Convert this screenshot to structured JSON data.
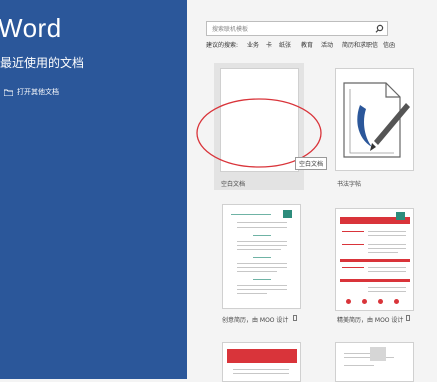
{
  "sidebar": {
    "app_title": "Word",
    "recent_title": "最近使用的文档",
    "open_other": "打开其他文档"
  },
  "search": {
    "placeholder": "搜索联机模板"
  },
  "suggested": [
    "建议的搜索:",
    "业务",
    "卡",
    "纸张",
    "教育",
    "活动",
    "简历和求职信",
    "信函"
  ],
  "templates": [
    {
      "label": "空白文档",
      "tooltip": "空白文档"
    },
    {
      "label": "书法字帖"
    },
    {
      "label": "创意简历，由 MOO 设计"
    },
    {
      "label": "精美简历，由 MOO 设计"
    }
  ],
  "colors": {
    "accent": "#2b579a",
    "resume_red": "#d9343a",
    "annotation": "#d9343a"
  }
}
